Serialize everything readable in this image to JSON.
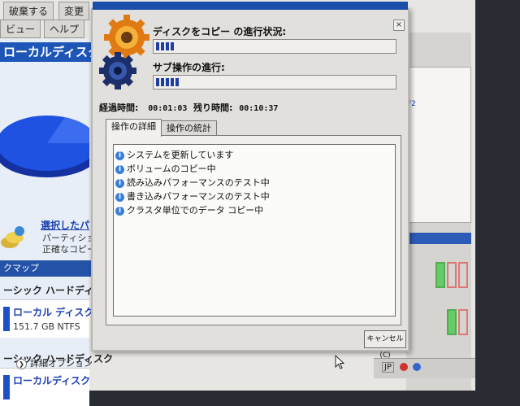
{
  "background_app": {
    "tabs": [
      "破棄する",
      "変更",
      "ビュー",
      "ヘルプ"
    ],
    "left_panel_title": "ローカルディスク",
    "operation_link": "選択したパ",
    "operation_desc": [
      "パーティション",
      "正確なコピー"
    ],
    "map_bar": "クマップ",
    "hdd_group_1": "ーシック ハードディスク",
    "volume_1": {
      "name": "ローカル ディスク (C",
      "size": "151.7 GB NTFS"
    },
    "hdd_group_2": "ーシック ハードディスク",
    "volume_2": {
      "name": "ローカルディスク"
    },
    "right_label": "F2"
  },
  "dialog": {
    "copy_progress_label": "ディスクをコピー の進行状況:",
    "sub_progress_label": "サブ操作の進行:",
    "copy_progress_percent": 8,
    "sub_progress_percent": 10,
    "elapsed_label": "経過時間:",
    "elapsed_value": "00:01:03",
    "remaining_label": "残り時間:",
    "remaining_value": "00:10:37",
    "tabs": [
      "操作の詳細",
      "操作の統計"
    ],
    "log_items": [
      "システムを更新しています",
      "ボリュームのコピー中",
      "読み込みパフォーマンスのテスト中",
      "書き込みパフォーマンスのテスト中",
      "クラスタ単位でのデータ コピー中"
    ],
    "cancel_label": "キャンセル(C)",
    "details_option": "詳細オプション",
    "close_glyph": "×"
  },
  "taskbar": {
    "ime": "JP"
  },
  "icons": [
    "gear-orange-icon",
    "gear-blue-icon",
    "info-icon",
    "chevron-down-icon",
    "close-icon",
    "mouse-cursor-icon"
  ],
  "colors": {
    "accent_blue": "#1e56b8",
    "progress_blue": "#1e3fa0",
    "dialog_bg": "#e2e0dc"
  }
}
